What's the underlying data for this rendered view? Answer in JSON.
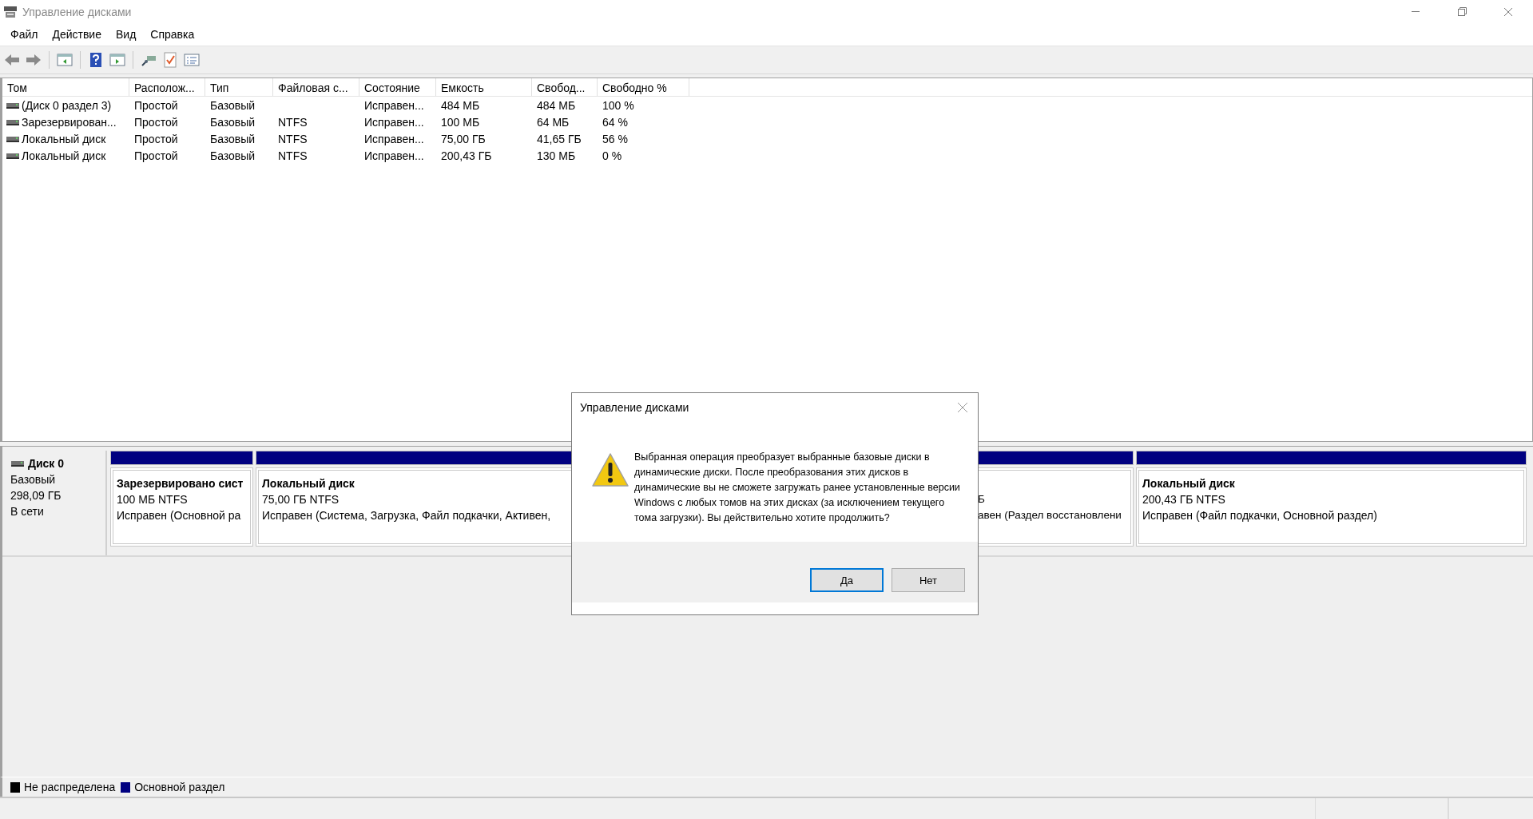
{
  "window": {
    "title": "Управление дисками"
  },
  "menu": [
    "Файл",
    "Действие",
    "Вид",
    "Справка"
  ],
  "table": {
    "columns": [
      "Том",
      "Располож...",
      "Тип",
      "Файловая с...",
      "Состояние",
      "Емкость",
      "Свобод...",
      "Свободно %"
    ],
    "rows": [
      {
        "cells": [
          "(Диск 0 раздел 3)",
          "Простой",
          "Базовый",
          "",
          "Исправен...",
          "484 МБ",
          "484 МБ",
          "100 %"
        ]
      },
      {
        "cells": [
          "Зарезервирован...",
          "Простой",
          "Базовый",
          "NTFS",
          "Исправен...",
          "100 МБ",
          "64 МБ",
          "64 %"
        ]
      },
      {
        "cells": [
          "Локальный диск",
          "Простой",
          "Базовый",
          "NTFS",
          "Исправен...",
          "75,00 ГБ",
          "41,65 ГБ",
          "56 %"
        ]
      },
      {
        "cells": [
          "Локальный диск",
          "Простой",
          "Базовый",
          "NTFS",
          "Исправен...",
          "200,43 ГБ",
          "130 МБ",
          "0 %"
        ]
      }
    ]
  },
  "disks": [
    {
      "name": "Диск 0",
      "type": "Базовый",
      "size": "298,09 ГБ",
      "status": "В сети",
      "partitions": [
        {
          "kind": "primary",
          "name": "Зарезервировано сист",
          "size": "100 МБ NTFS",
          "status": "Исправен (Основной ра"
        },
        {
          "kind": "primary",
          "name": "Локальный диск",
          "size": "75,00 ГБ NTFS",
          "status": "Исправен (Система, Загрузка, Файл подкачки, Активен,"
        },
        {
          "kind": "primary",
          "size": "Б",
          "status": "авен (Раздел восстановлени"
        },
        {
          "kind": "primary",
          "name": "Локальный диск",
          "size": "200,43 ГБ NTFS",
          "status": "Исправен (Файл подкачки, Основной раздел)"
        }
      ]
    }
  ],
  "legend": [
    {
      "label": "Не распределена",
      "color": "#000000"
    },
    {
      "label": "Основной раздел",
      "color": "#000080"
    }
  ],
  "dialog": {
    "title": "Управление дисками",
    "message": "Выбранная операция преобразует выбранные базовые диски в динамические диски. После преобразования этих дисков в динамические вы не сможете загружать ранее установленные версии Windows с любых томов на этих дисках (за исключением текущего тома загрузки). Вы действительно хотите продолжить?",
    "buttons": [
      {
        "label": "Да",
        "default": true
      },
      {
        "label": "Нет",
        "default": false
      }
    ]
  }
}
